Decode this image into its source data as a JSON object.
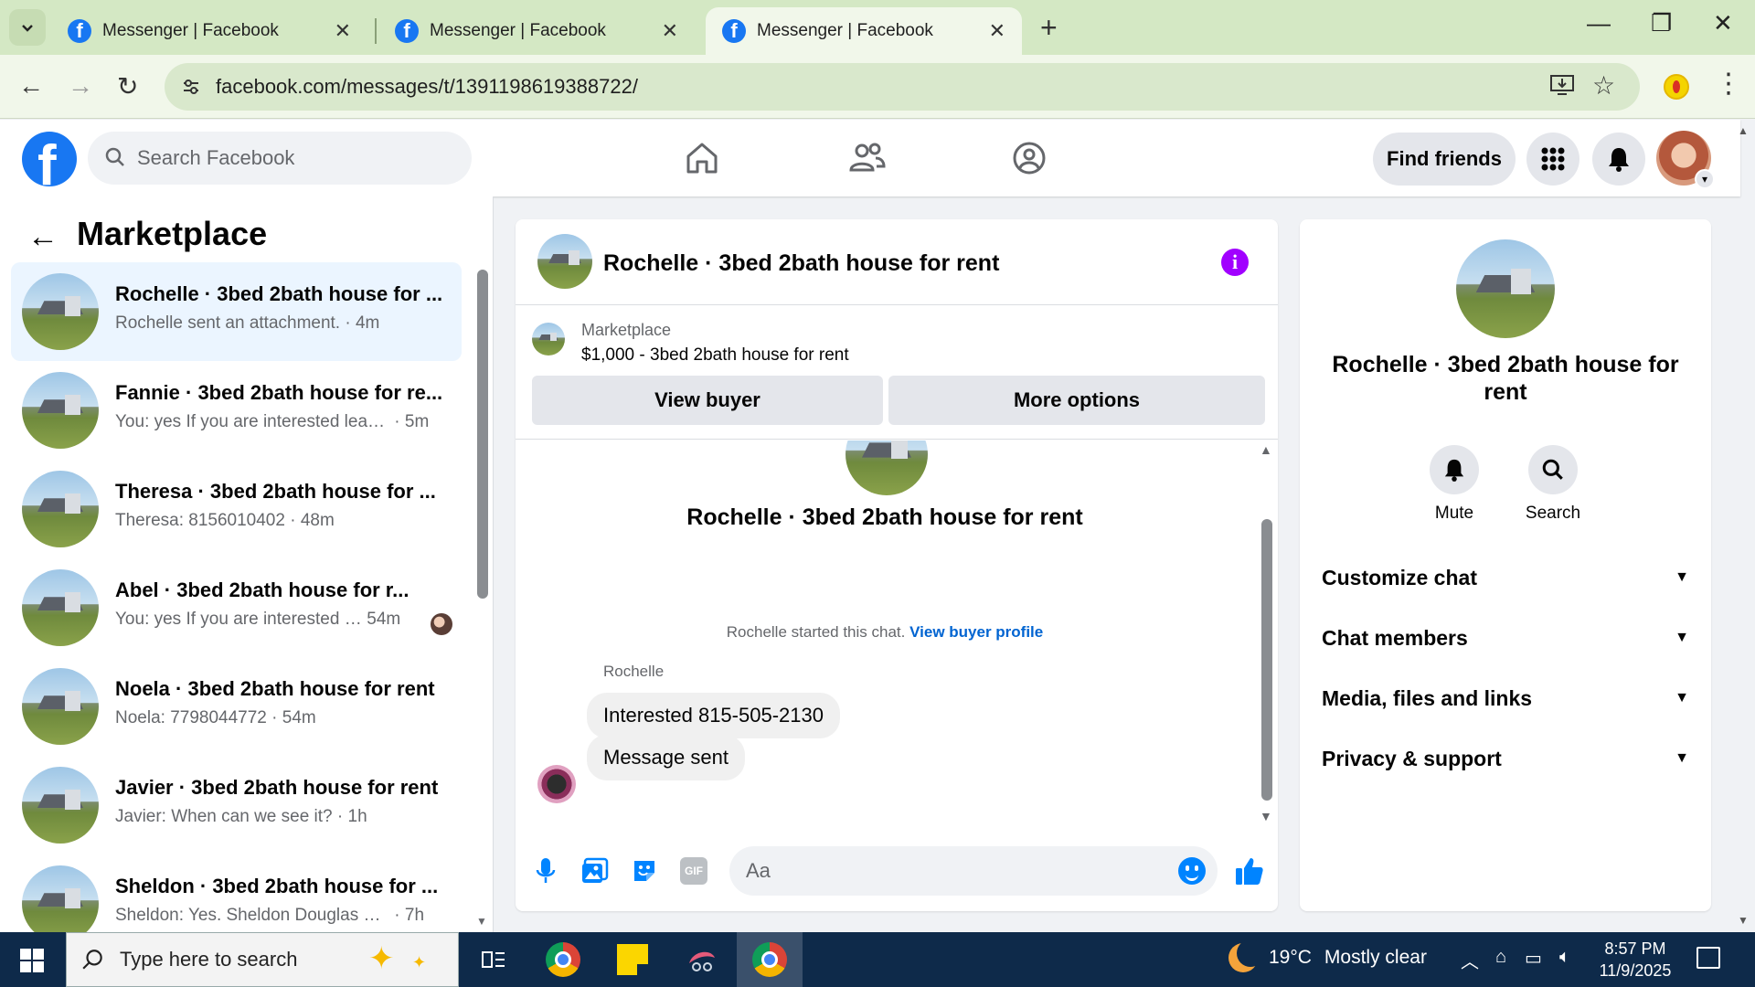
{
  "browser": {
    "tabs": [
      {
        "title": "Messenger | Facebook",
        "active": false
      },
      {
        "title": "Messenger | Facebook",
        "active": false
      },
      {
        "title": "Messenger | Facebook",
        "active": true
      }
    ],
    "new_tab_label": "+",
    "url": "facebook.com/messages/t/1391198619388722/"
  },
  "facebook": {
    "logo": "f",
    "search_placeholder": "Search Facebook",
    "find_friends": "Find friends"
  },
  "sidebar": {
    "title": "Marketplace",
    "chats": [
      {
        "name": "Rochelle · 3bed 2bath house for ...",
        "snippet": "Rochelle sent an attachment.",
        "time": "4m",
        "active": true
      },
      {
        "name": "Fannie · 3bed 2bath house for re...",
        "snippet": "You: yes If you are interested leave...",
        "time": "5m",
        "active": false
      },
      {
        "name": "Theresa · 3bed 2bath house for ...",
        "snippet": "Theresa: 8156010402",
        "time": "48m",
        "active": false
      },
      {
        "name": "Abel · 3bed 2bath house for r...",
        "snippet": "You: yes If you are interested l...",
        "time": "54m",
        "active": false
      },
      {
        "name": "Noela · 3bed 2bath house for rent",
        "snippet": "Noela: 7798044772",
        "time": "54m",
        "active": false
      },
      {
        "name": "Javier · 3bed 2bath house for rent",
        "snippet": "Javier: When can we see it?",
        "time": "1h",
        "active": false
      },
      {
        "name": "Sheldon · 3bed 2bath house for ...",
        "snippet": "Sheldon: Yes. Sheldon Douglas 779...",
        "time": "7h",
        "active": false
      }
    ]
  },
  "conversation": {
    "title": "Rochelle · 3bed 2bath house for rent",
    "marketplace_label": "Marketplace",
    "listing": "$1,000 - 3bed 2bath house for rent",
    "view_buyer": "View buyer",
    "more_options": "More options",
    "intro_title": "Rochelle · 3bed 2bath house for rent",
    "started_text": "Rochelle started this chat.",
    "view_buyer_profile": "View buyer profile",
    "sender": "Rochelle",
    "messages": [
      "Interested 815-505-2130",
      "Message sent"
    ],
    "composer_placeholder": "Aa",
    "gif_label": "GIF"
  },
  "details": {
    "title": "Rochelle · 3bed 2bath house for rent",
    "mute": "Mute",
    "search": "Search",
    "sections": [
      "Customize chat",
      "Chat members",
      "Media, files and links",
      "Privacy & support"
    ]
  },
  "taskbar": {
    "search_placeholder": "Type here to search",
    "temperature": "19°C",
    "weather": "Mostly clear",
    "time": "8:57 PM",
    "date": "11/9/2025"
  },
  "colors": {
    "facebook_blue": "#1877f2",
    "messenger_purple": "#a100ff",
    "link_blue": "#0064d1",
    "chrome_tab_green": "#d4e8c4",
    "taskbar_navy": "#0e2a4a"
  }
}
